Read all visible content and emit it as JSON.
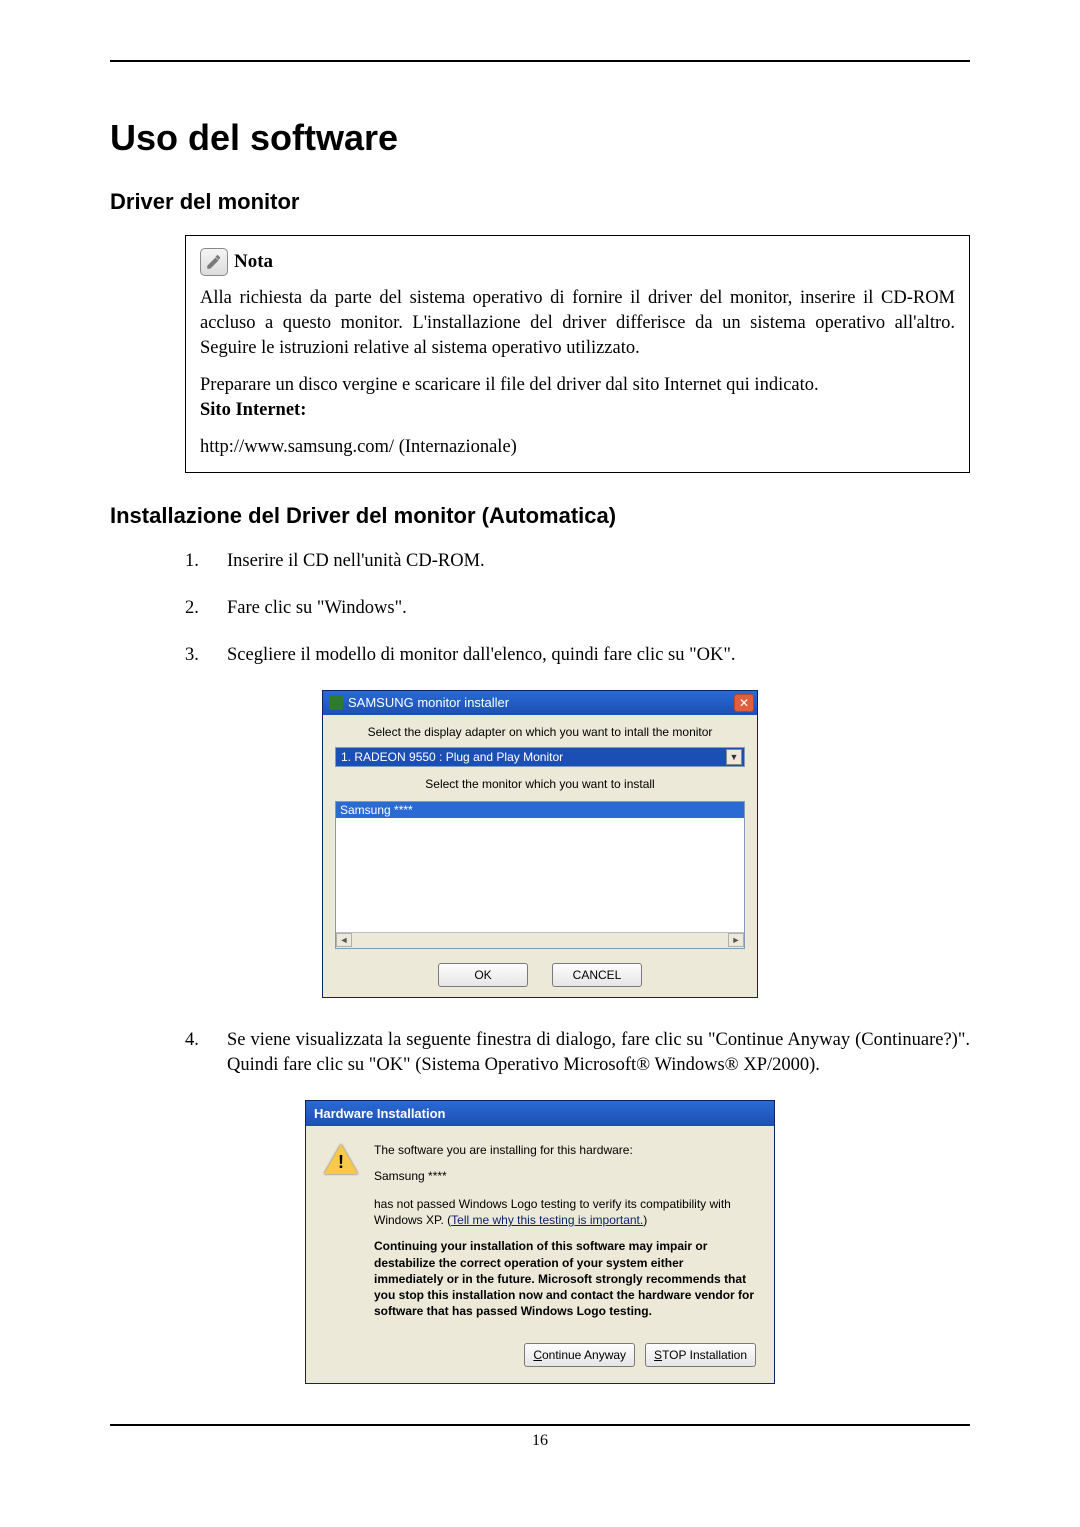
{
  "page": {
    "title": "Uso del software",
    "section1": "Driver del monitor",
    "section2": "Installazione del Driver del monitor (Automatica)",
    "pageNumber": "16"
  },
  "note": {
    "label": "Nota",
    "p1": "Alla richiesta da parte del sistema operativo di fornire il driver del monitor, inserire il CD-ROM accluso a questo monitor. L'installazione del driver differisce da un sistema operativo all'altro. Seguire le istruzioni relative al sistema operativo utilizzato.",
    "p2a": "Preparare un disco vergine e scaricare il file del driver dal sito Internet qui indicato.",
    "p2b": "Sito Internet:",
    "p3": "http://www.samsung.com/ (Internazionale)"
  },
  "steps": {
    "s1": "Inserire il CD nell'unità CD-ROM.",
    "s2": "Fare clic su \"Windows\".",
    "s3": "Scegliere il modello di monitor dall'elenco, quindi fare clic su \"OK\".",
    "s4": "Se viene visualizzata la seguente finestra di dialogo, fare clic su \"Continue Anyway (Continuare?)\". Quindi fare clic su \"OK\" (Sistema Operativo Microsoft® Windows® XP/2000)."
  },
  "dlg1": {
    "title": "SAMSUNG monitor installer",
    "lbl1": "Select the display adapter on which you want to intall the monitor",
    "combo": "1. RADEON 9550 : Plug and Play Monitor",
    "lbl2": "Select the monitor which you want to install",
    "listItem": "Samsung ****",
    "ok": "OK",
    "cancel": "CANCEL"
  },
  "dlg2": {
    "title": "Hardware Installation",
    "line1": "The software you are installing for this hardware:",
    "hwname": "Samsung ****",
    "line2a": "has not passed Windows Logo testing to verify its compatibility with Windows XP. (",
    "link": "Tell me why this testing is important.",
    "line2b": ")",
    "warn": "Continuing your installation of this software may impair or destabilize the correct operation of your system either immediately or in the future. Microsoft strongly recommends that you stop this installation now and contact the hardware vendor for software that has passed Windows Logo testing.",
    "btnContinue": "Continue Anyway",
    "btnStop": "STOP Installation"
  }
}
